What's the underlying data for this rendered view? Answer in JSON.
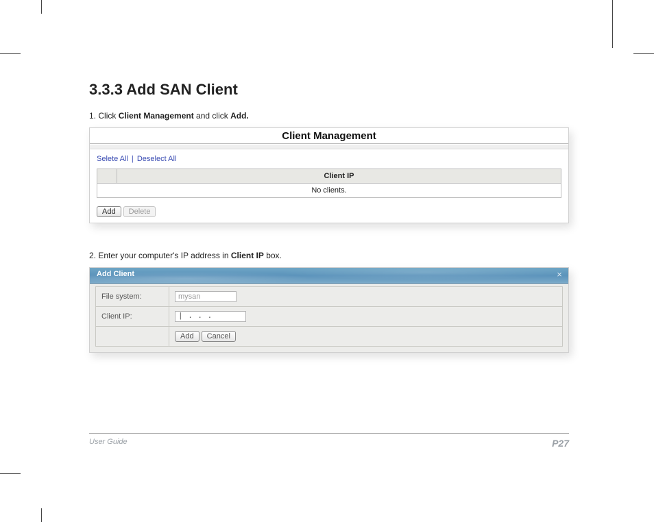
{
  "section": {
    "title": "3.3.3 Add SAN Client"
  },
  "step1": {
    "num": "1.",
    "pre": "Click ",
    "b1": "Client Management",
    "mid": " and click ",
    "b2": "Add."
  },
  "cm": {
    "title": "Client Management",
    "select_all": "Selete All",
    "deselect_all": "Deselect All",
    "col_client_ip": "Client IP",
    "no_clients": "No clients.",
    "add_btn": "Add",
    "delete_btn": "Delete"
  },
  "step2": {
    "num": "2.",
    "pre": "Enter your computer's IP address in ",
    "b1": "Client IP",
    "post": " box."
  },
  "ac": {
    "title": "Add Client",
    "close": "×",
    "fs_label": "File system:",
    "fs_value": "mysan",
    "ip_label": "Client IP:",
    "ip_value": "|   .      .      .",
    "add_btn": "Add",
    "cancel_btn": "Cancel"
  },
  "footer": {
    "left": "User Guide",
    "right": "P27"
  }
}
